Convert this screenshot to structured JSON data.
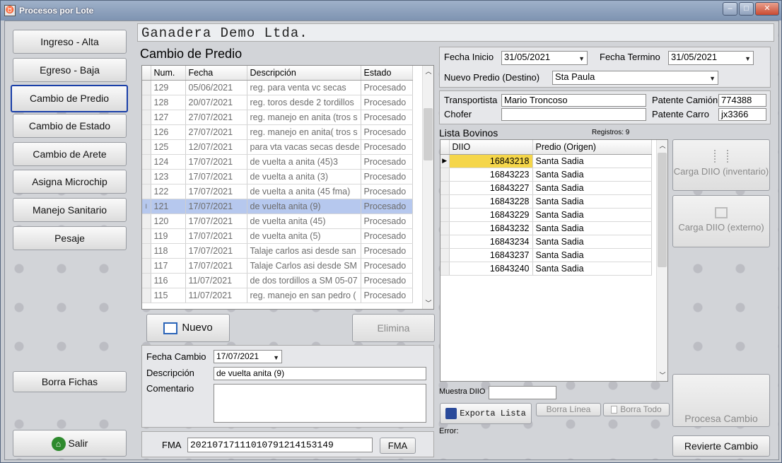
{
  "window": {
    "title": "Procesos por Lote"
  },
  "company": "Ganadera Demo Ltda.",
  "sidebar": {
    "items": [
      {
        "label": "Ingreso - Alta"
      },
      {
        "label": "Egreso - Baja"
      },
      {
        "label": "Cambio de Predio"
      },
      {
        "label": "Cambio de Estado"
      },
      {
        "label": "Cambio de Arete"
      },
      {
        "label": "Asigna Microchip"
      },
      {
        "label": "Manejo Sanitario"
      },
      {
        "label": "Pesaje"
      }
    ],
    "borra": "Borra Fichas",
    "salir": "Salir"
  },
  "section_title": "Cambio de Predio",
  "lots": {
    "headers": [
      "Num.",
      "Fecha",
      "Descripción",
      "Estado"
    ],
    "rows": [
      [
        "129",
        "05/06/2021",
        "reg. para venta vc secas",
        "Procesado"
      ],
      [
        "128",
        "20/07/2021",
        "reg. toros desde 2 tordillos",
        "Procesado"
      ],
      [
        "127",
        "27/07/2021",
        "reg. manejo en anita (tros s",
        "Procesado"
      ],
      [
        "126",
        "27/07/2021",
        "reg. manejo en anita( tros s",
        "Procesado"
      ],
      [
        "125",
        "12/07/2021",
        "para vta vacas secas desde",
        "Procesado"
      ],
      [
        "124",
        "17/07/2021",
        "de vuelta a anita (45)3",
        "Procesado"
      ],
      [
        "123",
        "17/07/2021",
        "de vuelta a anita (3)",
        "Procesado"
      ],
      [
        "122",
        "17/07/2021",
        "de vuelta a anita (45 fma)",
        "Procesado"
      ],
      [
        "121",
        "17/07/2021",
        "de vuelta anita (9)",
        "Procesado"
      ],
      [
        "120",
        "17/07/2021",
        "de vuelta anita (45)",
        "Procesado"
      ],
      [
        "119",
        "17/07/2021",
        "de vuelta anita (5)",
        "Procesado"
      ],
      [
        "118",
        "17/07/2021",
        "Talaje carlos asi desde san",
        "Procesado"
      ],
      [
        "117",
        "17/07/2021",
        "Talaje Carlos asi desde SM",
        "Procesado"
      ],
      [
        "116",
        "11/07/2021",
        "de dos tordillos a SM 05-07",
        "Procesado"
      ],
      [
        "115",
        "11/07/2021",
        "reg. manejo en san pedro (",
        "Procesado"
      ]
    ]
  },
  "nuevo": "Nuevo",
  "elimina": "Elimina",
  "form": {
    "fecha_label": "Fecha Cambio",
    "fecha": "17/07/2021",
    "desc_label": "Descripción",
    "desc": "de vuelta anita (9)",
    "coment_label": "Comentario",
    "coment": ""
  },
  "fma": {
    "label": "FMA",
    "value": "20210717111010791214153149",
    "btn": "FMA"
  },
  "top": {
    "fi_label": "Fecha Inicio",
    "fi": "31/05/2021",
    "ft_label": "Fecha Termino",
    "ft": "31/05/2021",
    "np_label": "Nuevo Predio (Destino)",
    "np": "Sta Paula"
  },
  "transport": {
    "t_label": "Transportista",
    "t": "Mario Troncoso",
    "pc_label": "Patente Camión",
    "pc": "774388",
    "c_label": "Chofer",
    "c": "",
    "pk_label": "Patente Carro",
    "pk": "jx3366"
  },
  "bovinos": {
    "title": "Lista Bovinos",
    "reg_label": "Registros:",
    "reg": "9",
    "headers": [
      "DIIO",
      "Predio (Origen)"
    ],
    "rows": [
      [
        "16843218",
        "Santa Sadia"
      ],
      [
        "16843223",
        "Santa Sadia"
      ],
      [
        "16843227",
        "Santa Sadia"
      ],
      [
        "16843228",
        "Santa Sadia"
      ],
      [
        "16843229",
        "Santa Sadia"
      ],
      [
        "16843232",
        "Santa Sadia"
      ],
      [
        "16843234",
        "Santa Sadia"
      ],
      [
        "16843237",
        "Santa Sadia"
      ],
      [
        "16843240",
        "Santa Sadia"
      ]
    ]
  },
  "muestra_label": "Muestra DIIO",
  "muestra": "",
  "exporta": "Exporta Lista",
  "borra_linea": "Borra Línea",
  "borra_todo": "Borra Todo",
  "error_label": "Error:",
  "carga_inv": "Carga DIIO (inventario)",
  "carga_ext": "Carga DIIO (externo)",
  "procesa": "Procesa Cambio",
  "revierte": "Revierte Cambio",
  "colors": {
    "selected_row": "#b6c8ee",
    "current_cell": "#f5d64a",
    "title_bar": "#8fa3bf"
  }
}
